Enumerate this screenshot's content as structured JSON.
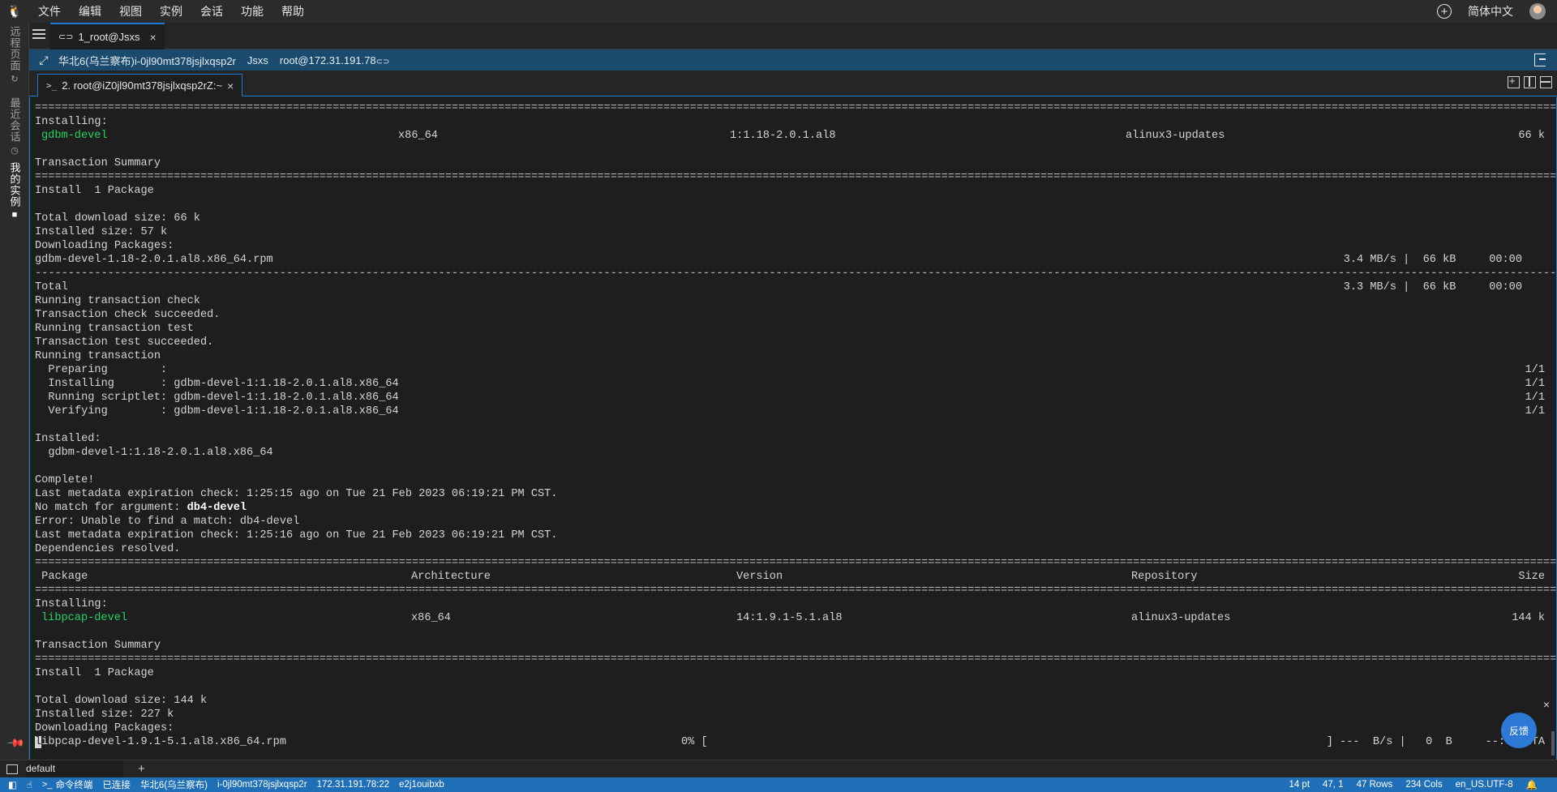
{
  "menubar": {
    "items": [
      "文件",
      "编辑",
      "视图",
      "实例",
      "会话",
      "功能",
      "帮助"
    ],
    "language": "简体中文"
  },
  "sidebar": {
    "tabs": [
      "远程页面",
      "最近会话",
      "我的实例"
    ]
  },
  "session_tab": {
    "label": "1_root@Jsxs"
  },
  "infobar": {
    "region": "华北6(乌兰察布)",
    "instance_id": "i-0jl90mt378jsjlxqsp2r",
    "hostname": "Jsxs",
    "login": "root@172.31.191.78"
  },
  "terminal_tab": {
    "label": "2. root@iZ0jl90mt378jsjlxqsp2rZ:~"
  },
  "terminal": {
    "separator": "=============================================================================================================================================================================================================================================",
    "dash_separator": "-------------------------------------------------------------------------------------------------------------------------------------------------------------------------------------------------------------------------------------------------------",
    "installing": "Installing:",
    "pkg1": {
      "name": "gdbm-devel",
      "arch": "x86_64",
      "version": "1:1.18-2.0.1.al8",
      "repo": "alinux3-updates",
      "size": "66 k"
    },
    "transaction_summary": "Transaction Summary",
    "install_count": "Install  1 Package",
    "total_download_1": "Total download size: 66 k",
    "installed_size_1": "Installed size: 57 k",
    "downloading": "Downloading Packages:",
    "rpm1": "gdbm-devel-1.18-2.0.1.al8.x86_64.rpm",
    "rpm1_speed": "3.4 MB/s |  66 kB     00:00",
    "total": "Total",
    "total_speed": "3.3 MB/s |  66 kB     00:00",
    "run_check": "Running transaction check",
    "check_ok": "Transaction check succeeded.",
    "run_test": "Running transaction test",
    "test_ok": "Transaction test succeeded.",
    "run_tx": "Running transaction",
    "preparing": "  Preparing        :",
    "installing_step": "  Installing       : gdbm-devel-1:1.18-2.0.1.al8.x86_64",
    "scriptlet_step": "  Running scriptlet: gdbm-devel-1:1.18-2.0.1.al8.x86_64",
    "verifying_step": "  Verifying        : gdbm-devel-1:1.18-2.0.1.al8.x86_64",
    "step_count": "1/1",
    "installed_label": "Installed:",
    "installed_pkg": "  gdbm-devel-1:1.18-2.0.1.al8.x86_64",
    "complete": "Complete!",
    "metadata_1": "Last metadata expiration check: 1:25:15 ago on Tue 21 Feb 2023 06:19:21 PM CST.",
    "no_match_prefix": "No match for argument: ",
    "no_match_arg": "db4-devel",
    "error_line": "Error: Unable to find a match: db4-devel",
    "metadata_2": "Last metadata expiration check: 1:25:16 ago on Tue 21 Feb 2023 06:19:21 PM CST.",
    "deps_resolved": "Dependencies resolved.",
    "headers": {
      "package": " Package",
      "arch": "Architecture",
      "version": "Version",
      "repo": "Repository",
      "size": "Size"
    },
    "pkg2": {
      "name": "libpcap-devel",
      "arch": "x86_64",
      "version": "14:1.9.1-5.1.al8",
      "repo": "alinux3-updates",
      "size": "144 k"
    },
    "total_download_2": "Total download size: 144 k",
    "installed_size_2": "Installed size: 227 k",
    "rpm2_first": "l",
    "rpm2_rest": "ibpcap-devel-1.9.1-5.1.al8.x86_64.rpm",
    "rpm2_progress": "0% [",
    "rpm2_tail": "] ---  B/s |   0  B     --:-- ETA"
  },
  "feedback": {
    "label": "反馈"
  },
  "panel": {
    "name": "default"
  },
  "statusbar": {
    "terminal": "命令终端",
    "connected": "已连接",
    "region": "华北6(乌兰察布)",
    "instance": "i-0jl90mt378jsjlxqsp2r",
    "ip": "172.31.191.78:22",
    "session": "e2j1ouibxb",
    "font_size": "14 pt",
    "cursor_pos": "47, 1",
    "rows": "47 Rows",
    "cols": "234 Cols",
    "encoding": "en_US.UTF-8"
  },
  "colors": {
    "accent": "#1e7bd7",
    "statusbar": "#1f6fb8",
    "infobar": "#1a4a6e",
    "package_green": "#23d160"
  }
}
